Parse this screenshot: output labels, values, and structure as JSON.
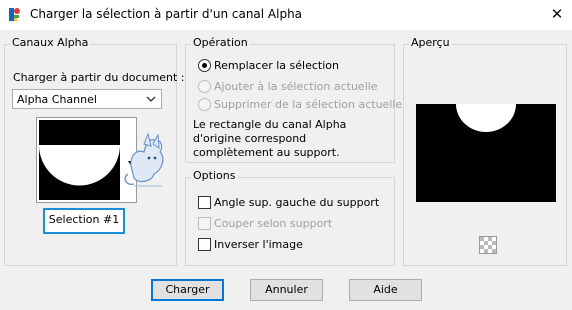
{
  "window": {
    "title": "Charger la sélection à partir d'un canal Alpha",
    "close_glyph": "✕"
  },
  "canaux": {
    "group_label": "Canaux Alpha",
    "load_from_label": "Charger à partir du document :",
    "document_value": "Alpha Channel",
    "selection_name": "Selection #1"
  },
  "operation": {
    "group_label": "Opération",
    "options": [
      {
        "label": "Remplacer la sélection",
        "checked": true,
        "enabled": true
      },
      {
        "label": "Ajouter à la sélection actuelle",
        "checked": false,
        "enabled": false
      },
      {
        "label": "Supprimer de la sélection actuelle",
        "checked": false,
        "enabled": false
      }
    ],
    "description": [
      "Le rectangle du canal Alpha",
      "d'origine correspond",
      "complètement au support."
    ]
  },
  "options": {
    "group_label": "Options",
    "items": [
      {
        "label": "Angle sup. gauche du support",
        "checked": false,
        "enabled": true
      },
      {
        "label": "Couper selon support",
        "checked": false,
        "enabled": false
      },
      {
        "label": "Inverser l'image",
        "checked": false,
        "enabled": true
      }
    ]
  },
  "preview": {
    "group_label": "Aperçu"
  },
  "buttons": {
    "charger": "Charger",
    "annuler": "Annuler",
    "aide": "Aide"
  },
  "colors": {
    "accent": "#0078d7",
    "selection_border": "#1a8fd4",
    "preview_black": "#000000",
    "preview_white": "#ffffff"
  },
  "icons": {
    "app": "paintshop-app-icon",
    "dropdown": "chevron-down-icon",
    "thumbnail_dropdown": "triangle-down-icon",
    "transparency": "checkerboard-icon",
    "watermark": "fox-watermark-icon"
  }
}
